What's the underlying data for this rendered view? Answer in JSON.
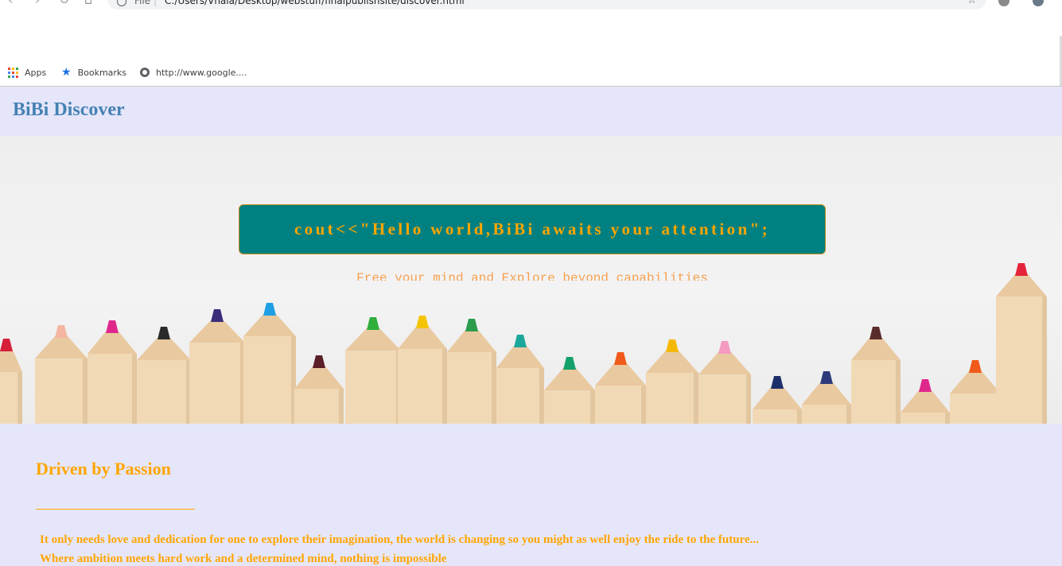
{
  "browser": {
    "url_scheme": "File",
    "url_separator": "|",
    "url_path": "C:/Users/Vhala/Desktop/webstuff/finalpublishsite/discover.html",
    "bookmarks": [
      {
        "label": "Apps",
        "icon": "apps-grid-icon"
      },
      {
        "label": "Bookmarks",
        "icon": "star-icon"
      },
      {
        "label": "http://www.google....",
        "icon": "globe-icon"
      }
    ]
  },
  "site": {
    "brand": "BiBi Discover",
    "brand_color": "#4682b4",
    "accent_color": "#ffa500",
    "background": "#e6e6fa"
  },
  "hero": {
    "headline": "cout<<\"Hello world,BiBi awaits your attention\";",
    "headline_bg": "#008080",
    "subtitle": "Free your mind and Explore beyond capabilities"
  },
  "section": {
    "heading": "Driven by Passion",
    "line1": "It only needs love and dedication for one to explore their imagination, the world is changing so you might as well enjoy the ride to the future...",
    "line2": "Where ambition meets hard work and a determined mind, nothing is impossible"
  }
}
